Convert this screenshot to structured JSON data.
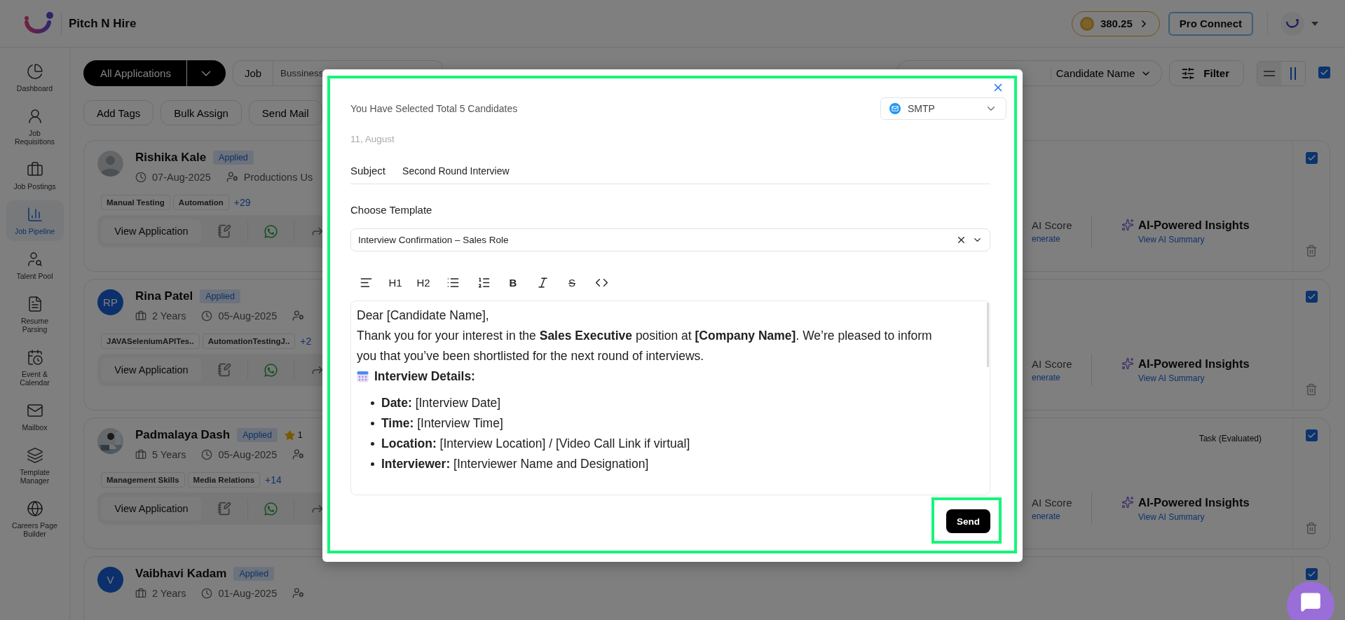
{
  "header": {
    "brand": "Pitch N Hire",
    "coins": "380.25",
    "pro_button": "Pro Connect"
  },
  "sidebar": {
    "items": [
      {
        "label": "Dashboard",
        "selected": false
      },
      {
        "label": "Job Requisitions",
        "selected": false
      },
      {
        "label": "Job Postings",
        "selected": false
      },
      {
        "label": "Job Pipeline",
        "selected": true
      },
      {
        "label": "Talent Pool",
        "selected": false
      },
      {
        "label": "Resume Parsing",
        "selected": false
      },
      {
        "label": "Event & Calendar",
        "selected": false
      },
      {
        "label": "Mailbox",
        "selected": false
      },
      {
        "label": "Template Manager",
        "selected": false
      },
      {
        "label": "Careers Page Builder",
        "selected": false
      }
    ]
  },
  "toolbar": {
    "view_selector": "All Applications",
    "job_label": "Job",
    "job_value": "Bussiness",
    "sort_field": "Candidate Name",
    "filter_button": "Filter",
    "view_modes": [
      {
        "selected": false
      },
      {
        "selected": true
      }
    ],
    "select_all_checked": true
  },
  "bulk_actions": [
    "Add Tags",
    "Bulk Assign",
    "Send Mail"
  ],
  "candidates": [
    {
      "name": "Rishika Kale",
      "status": "Applied",
      "avatar": {
        "kind": "placeholder"
      },
      "date": "07-Aug-2025",
      "owner": "Productions Us",
      "tags": [
        "Manual Testing",
        "Automation"
      ],
      "more_tags": "+29",
      "action": "View Application",
      "ai_score": "AI Score",
      "ai_link": "enerate",
      "insights_title": "AI-Powered Insights",
      "insights_link": "View AI Summary",
      "checked": true
    },
    {
      "name": "Rina Patel",
      "status": "Applied",
      "avatar": {
        "kind": "initials",
        "initials": "RP"
      },
      "experience": "2 Years",
      "date": "05-Aug-2025",
      "tags": [
        "JAVASeleniumAPITes..",
        "AutomationTestingJ.."
      ],
      "more_tags": "+2",
      "action": "View Application",
      "ai_score": "AI Score",
      "ai_link": "enerate",
      "insights_title": "AI-Powered Insights",
      "insights_link": "View AI Summary",
      "checked": true
    },
    {
      "name": "Padmalaya Dash",
      "status": "Applied",
      "avatar": {
        "kind": "picture"
      },
      "rating": "1",
      "experience": "5 Years",
      "date": "05-Aug-2025",
      "task": "Task (Evaluated)",
      "tags": [
        "Management Skills",
        "Media Relations"
      ],
      "more_tags": "+14",
      "action": "View Application",
      "ai_score": "AI Score",
      "ai_link": "enerate",
      "insights_title": "AI-Powered Insights",
      "insights_link": "View AI Summary",
      "checked": true
    },
    {
      "name": "Vaibhavi Kadam",
      "status": "Applied",
      "avatar": {
        "kind": "initials",
        "initials": "V"
      },
      "experience": "2 Years",
      "date": "01-Aug-2025",
      "checked": true
    }
  ],
  "email_dialog": {
    "selection_summary": "You Have Selected Total 5 Candidates",
    "provider": "SMTP",
    "date": "11, August",
    "subject_label": "Subject",
    "subject": "Second Round Interview",
    "template_label": "Choose Template",
    "template": "Interview Confirmation – Sales Role",
    "editor_tools": [
      {
        "kind": "align"
      },
      {
        "kind": "heading",
        "label": "H1"
      },
      {
        "kind": "heading",
        "label": "H2"
      },
      {
        "kind": "bullets"
      },
      {
        "kind": "numbers"
      },
      {
        "kind": "bold",
        "label": "B"
      },
      {
        "kind": "italic"
      },
      {
        "kind": "strike",
        "label": "S"
      },
      {
        "kind": "code"
      }
    ],
    "body": {
      "greeting": "Dear [Candidate Name],",
      "paragraph": "Thank you for your interest in the **Sales Executive** position at **[Company Name]**. We’re pleased to inform you that you’ve been shortlisted for the next round of interviews.",
      "details_heading": "Interview Details:",
      "details": [
        "**Date:** [Interview Date]",
        "**Time:** [Interview Time]",
        "**Location:** [Interview Location] / [Video Call Link if virtual]",
        "**Interviewer:** [Interviewer Name and Designation]"
      ]
    },
    "send_button": "Send"
  }
}
